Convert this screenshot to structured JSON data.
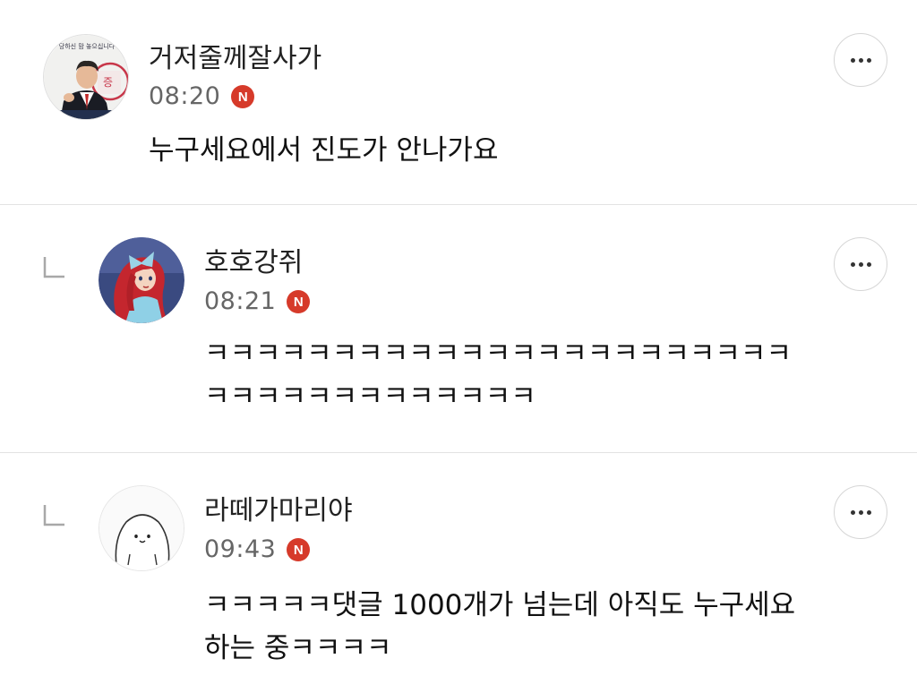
{
  "accent": {
    "badge_color": "#d63a2a"
  },
  "comments": [
    {
      "username": "거저줄께잘사가",
      "time": "08:20",
      "badge": "N",
      "lines": [
        "누구세요에서 진도가 안나가요"
      ],
      "is_reply": false,
      "avatar_icon": "politician-photo-avatar",
      "avatar_text": [
        "당하신 맘 놓으십니다",
        "증"
      ],
      "more_icon": "more-horizontal-icon"
    },
    {
      "username": "호호강쥐",
      "time": "08:21",
      "badge": "N",
      "lines": [
        "ㅋㅋㅋㅋㅋㅋㅋㅋㅋㅋㅋㅋㅋㅋㅋㅋㅋㅋㅋㅋㅋㅋㅋ",
        "ㅋㅋㅋㅋㅋㅋㅋㅋㅋㅋㅋㅋㅋ"
      ],
      "is_reply": true,
      "avatar_icon": "mermaid-avatar",
      "reply_icon": "reply-arrow-icon",
      "more_icon": "more-horizontal-icon"
    },
    {
      "username": "라떼가마리야",
      "time": "09:43",
      "badge": "N",
      "lines": [
        "ㅋㅋㅋㅋㅋ댓글 1000개가 넘는데 아직도 누구세요",
        "하는 중ㅋㅋㅋㅋ"
      ],
      "is_reply": true,
      "avatar_icon": "round-character-avatar",
      "reply_icon": "reply-arrow-icon",
      "more_icon": "more-horizontal-icon"
    }
  ]
}
